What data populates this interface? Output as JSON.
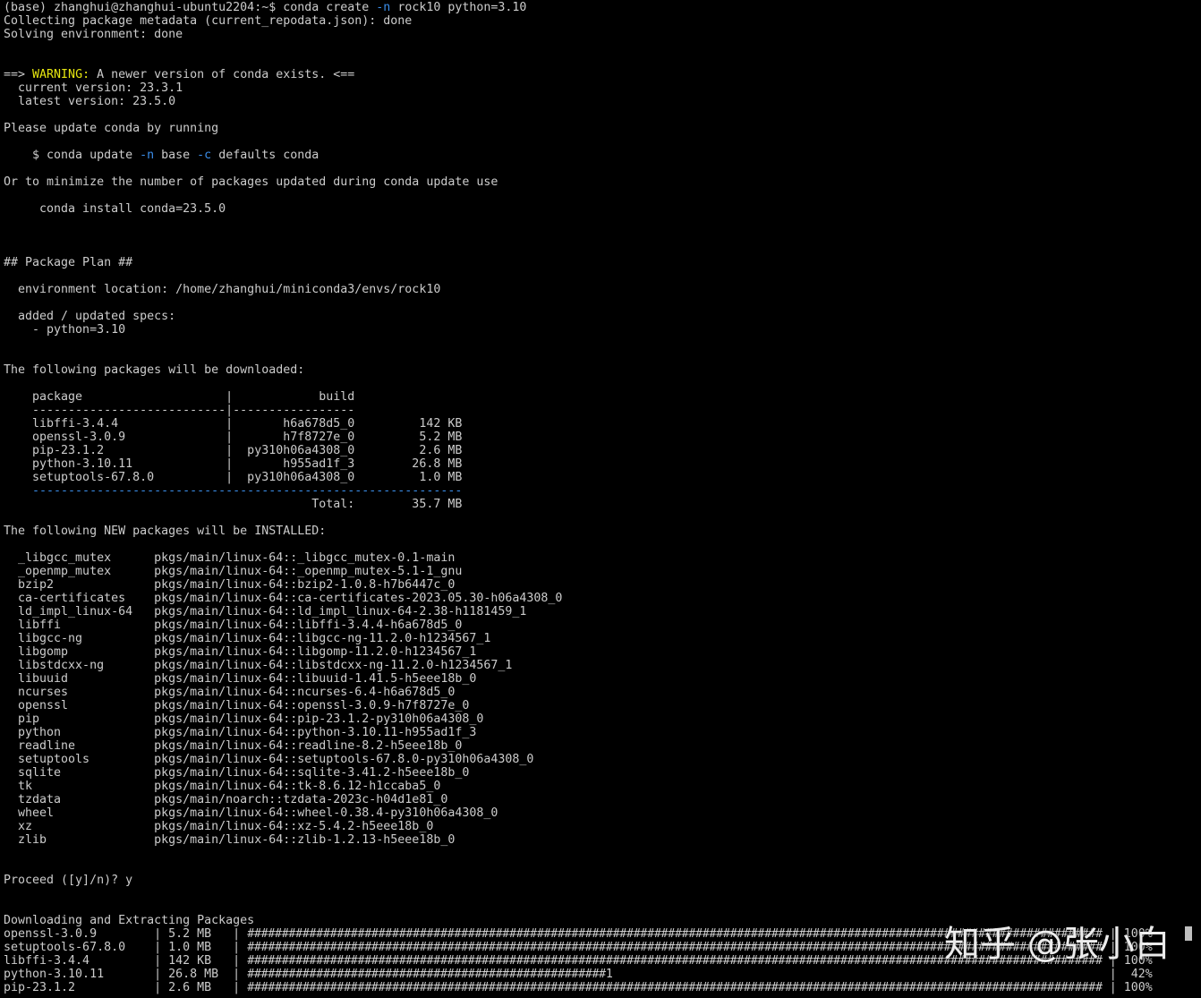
{
  "terminal": {
    "prompt": "(base) zhanghui@zhanghui-ubuntu2204:~$ ",
    "command_pre": "conda create ",
    "command_flag": "-n",
    "command_post": " rock10 python=3.10",
    "collecting": "Collecting package metadata (current_repodata.json): done",
    "solving": "Solving environment: done",
    "warn_arrow": "==> ",
    "warn_word": "WARNING:",
    "warn_rest": " A newer version of conda exists. <==",
    "current_version": "  current version: 23.3.1",
    "latest_version": "  latest version: 23.5.0",
    "please_update": "Please update conda by running",
    "update_cmd_pre": "    $ conda update ",
    "update_flag_n": "-n",
    "update_cmd_mid": " base ",
    "update_flag_c": "-c",
    "update_cmd_post": " defaults conda",
    "minimize_line": "Or to minimize the number of packages updated during conda update use",
    "install_cmd": "     conda install conda=23.5.0",
    "plan_header": "## Package Plan ##",
    "env_location": "  environment location: /home/zhanghui/miniconda3/envs/rock10",
    "added_specs": "  added / updated specs:",
    "spec_python": "    - python=3.10",
    "download_header": "The following packages will be downloaded:",
    "table_header": "    package                    |            build",
    "table_divider": "    ---------------------------|-----------------",
    "download_rows": [
      "    libffi-3.4.4               |       h6a678d5_0         142 KB",
      "    openssl-3.0.9              |       h7f8727e_0         5.2 MB",
      "    pip-23.1.2                 |  py310h06a4308_0         2.6 MB",
      "    python-3.10.11             |       h955ad1f_3        26.8 MB",
      "    setuptools-67.8.0          |  py310h06a4308_0         1.0 MB"
    ],
    "total_divider": "    ------------------------------------------------------------",
    "total_row": "                                           Total:        35.7 MB",
    "install_header": "The following NEW packages will be INSTALLED:",
    "install_rows": [
      "  _libgcc_mutex      pkgs/main/linux-64::_libgcc_mutex-0.1-main",
      "  _openmp_mutex      pkgs/main/linux-64::_openmp_mutex-5.1-1_gnu",
      "  bzip2              pkgs/main/linux-64::bzip2-1.0.8-h7b6447c_0",
      "  ca-certificates    pkgs/main/linux-64::ca-certificates-2023.05.30-h06a4308_0",
      "  ld_impl_linux-64   pkgs/main/linux-64::ld_impl_linux-64-2.38-h1181459_1",
      "  libffi             pkgs/main/linux-64::libffi-3.4.4-h6a678d5_0",
      "  libgcc-ng          pkgs/main/linux-64::libgcc-ng-11.2.0-h1234567_1",
      "  libgomp            pkgs/main/linux-64::libgomp-11.2.0-h1234567_1",
      "  libstdcxx-ng       pkgs/main/linux-64::libstdcxx-ng-11.2.0-h1234567_1",
      "  libuuid            pkgs/main/linux-64::libuuid-1.41.5-h5eee18b_0",
      "  ncurses            pkgs/main/linux-64::ncurses-6.4-h6a678d5_0",
      "  openssl            pkgs/main/linux-64::openssl-3.0.9-h7f8727e_0",
      "  pip                pkgs/main/linux-64::pip-23.1.2-py310h06a4308_0",
      "  python             pkgs/main/linux-64::python-3.10.11-h955ad1f_3",
      "  readline           pkgs/main/linux-64::readline-8.2-h5eee18b_0",
      "  setuptools         pkgs/main/linux-64::setuptools-67.8.0-py310h06a4308_0",
      "  sqlite             pkgs/main/linux-64::sqlite-3.41.2-h5eee18b_0",
      "  tk                 pkgs/main/linux-64::tk-8.6.12-h1ccaba5_0",
      "  tzdata             pkgs/main/noarch::tzdata-2023c-h04d1e81_0",
      "  wheel              pkgs/main/linux-64::wheel-0.38.4-py310h06a4308_0",
      "  xz                 pkgs/main/linux-64::xz-5.4.2-h5eee18b_0",
      "  zlib               pkgs/main/linux-64::zlib-1.2.13-h5eee18b_0"
    ],
    "proceed": "Proceed ([y]/n)? y",
    "downloading_header": "Downloading and Extracting Packages",
    "progress_rows": [
      {
        "name": "openssl-3.0.9",
        "size": "5.2 MB",
        "percent": "100%",
        "fraction": 1.0
      },
      {
        "name": "setuptools-67.8.0",
        "size": "1.0 MB",
        "percent": "100%",
        "fraction": 1.0
      },
      {
        "name": "libffi-3.4.4",
        "size": "142 KB",
        "percent": "100%",
        "fraction": 1.0
      },
      {
        "name": "python-3.10.11",
        "size": "26.8 MB",
        "percent": "42%",
        "fraction": 0.42
      },
      {
        "name": "pip-23.1.2",
        "size": "2.6 MB",
        "percent": "100%",
        "fraction": 1.0
      }
    ],
    "progress_spinner": "1"
  },
  "watermark": "知乎 @张小白",
  "colors": {
    "background": "#000000",
    "text": "#cccccc",
    "flag": "#3b8eea",
    "warning": "#e5e510"
  }
}
